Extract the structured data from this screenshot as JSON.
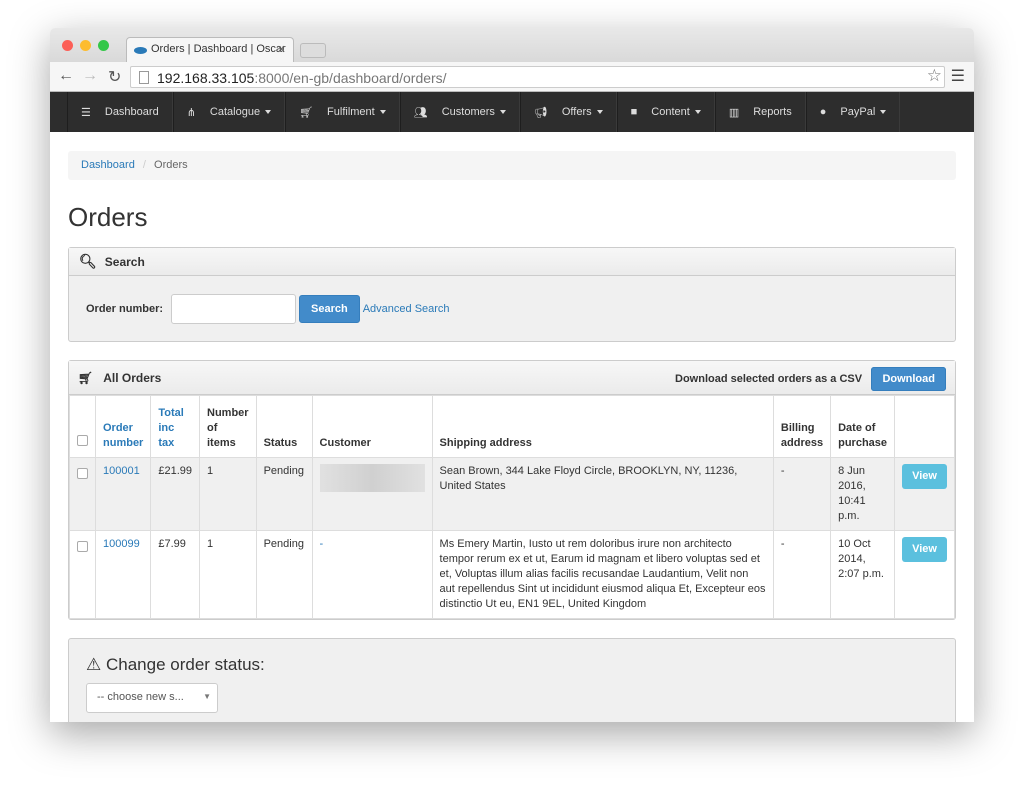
{
  "browser": {
    "tab_title": "Orders | Dashboard | Oscar",
    "url_host": "192.168.33.105",
    "url_rest": ":8000/en-gb/dashboard/orders/"
  },
  "nav": [
    {
      "label": "Dashboard",
      "icon": "list-icon",
      "dropdown": false
    },
    {
      "label": "Catalogue",
      "icon": "sitemap-icon",
      "dropdown": true
    },
    {
      "label": "Fulfilment",
      "icon": "cart-icon",
      "dropdown": true
    },
    {
      "label": "Customers",
      "icon": "users-icon",
      "dropdown": true
    },
    {
      "label": "Offers",
      "icon": "bullhorn-icon",
      "dropdown": true
    },
    {
      "label": "Content",
      "icon": "folder-icon",
      "dropdown": true
    },
    {
      "label": "Reports",
      "icon": "chart-icon",
      "dropdown": false
    },
    {
      "label": "PayPal",
      "icon": "globe-icon",
      "dropdown": true
    }
  ],
  "breadcrumb": {
    "home": "Dashboard",
    "sep": "/",
    "current": "Orders"
  },
  "page_title": "Orders",
  "search": {
    "title": "Search",
    "label": "Order number:",
    "value": "",
    "button": "Search",
    "advanced": "Advanced Search"
  },
  "orders": {
    "title": "All Orders",
    "download_label": "Download selected orders as a CSV",
    "download_button": "Download",
    "columns": [
      "Order number",
      "Total inc tax",
      "Number of items",
      "Status",
      "Customer",
      "Shipping address",
      "Billing address",
      "Date of purchase"
    ],
    "rows": [
      {
        "number": "100001",
        "total": "£21.99",
        "items": "1",
        "status": "Pending",
        "customer": "",
        "shipping": "Sean Brown, 344 Lake Floyd Circle, BROOKLYN, NY, 11236, United States",
        "billing": "-",
        "date": "8 Jun 2016, 10:41 p.m.",
        "action": "View"
      },
      {
        "number": "100099",
        "total": "£7.99",
        "items": "1",
        "status": "Pending",
        "customer": "-",
        "shipping": "Ms Emery Martin, Iusto ut rem doloribus irure non architecto tempor rerum ex et ut, Earum id magnam et libero voluptas sed et et, Voluptas illum alias facilis recusandae Laudantium, Velit non aut repellendus Sint ut incididunt eiusmod aliqua Et, Excepteur eos distinctio Ut eu, EN1 9EL, United Kingdom",
        "billing": "-",
        "date": "10 Oct 2014, 2:07 p.m.",
        "action": "View"
      }
    ]
  },
  "status_change": {
    "title": "Change order status:",
    "select": "-- choose new s..."
  }
}
